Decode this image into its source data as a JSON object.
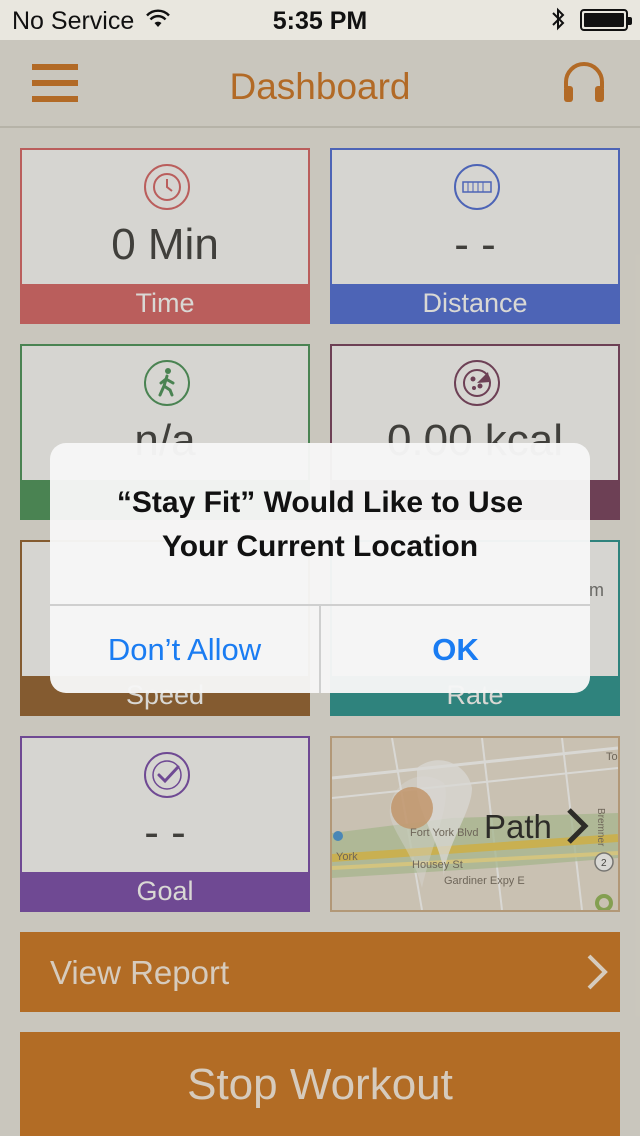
{
  "status_bar": {
    "carrier": "No Service",
    "time": "5:35 PM"
  },
  "nav": {
    "title": "Dashboard",
    "menu_icon": "hamburger-menu-icon",
    "right_icon": "headphones-icon"
  },
  "tiles": {
    "time": {
      "value": "0 Min",
      "label": "Time",
      "icon": "clock-icon",
      "color": "#d45659"
    },
    "distance": {
      "value": "- -",
      "label": "Distance",
      "icon": "odometer-icon",
      "color": "#3d5fd6"
    },
    "pace": {
      "value": "n/a",
      "label": "",
      "icon": "walking-person-icon",
      "color": "#3a8a4c"
    },
    "calories": {
      "value": "0.00 kcal",
      "label": "",
      "icon": "pizza-icon",
      "color": "#6a2d50"
    },
    "speed": {
      "value": "",
      "label": "Speed",
      "color": "#8a531d"
    },
    "rate": {
      "value": "",
      "label": "Rate",
      "unit": "m",
      "color": "#148a87"
    },
    "goal": {
      "value": "- -",
      "label": "Goal",
      "icon": "checkmark-circle-icon",
      "color": "#6c3aa6"
    },
    "map": {
      "label": "Path",
      "streets": [
        "Fort York Blvd",
        "York",
        "Housey St",
        "Gardiner Expy E",
        "Bremner",
        "To"
      ],
      "route_shield": "2"
    }
  },
  "buttons": {
    "view_report": "View Report",
    "stop_workout": "Stop Workout"
  },
  "alert": {
    "title_line1": "“Stay Fit” Would Like to Use",
    "title_line2": "Your Current Location",
    "deny_label": "Don’t Allow",
    "ok_label": "OK"
  },
  "colors": {
    "accent": "#c9670e",
    "alert_button": "#1a7cf2"
  }
}
